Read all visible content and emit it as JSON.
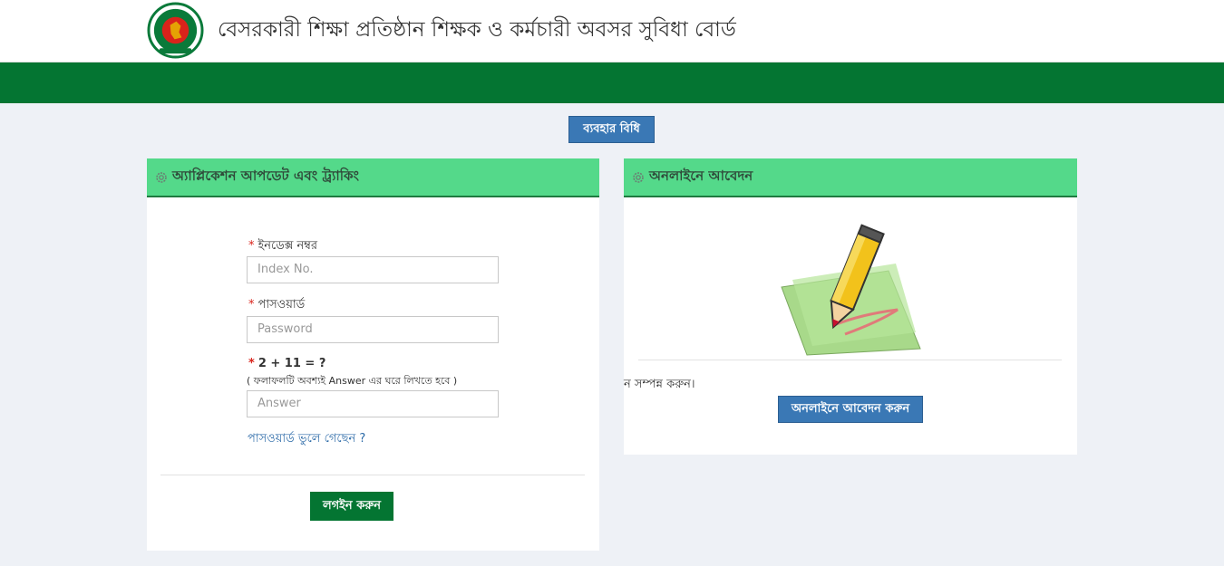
{
  "header": {
    "title": "বেসরকারী শিক্ষা প্রতিষ্ঠান শিক্ষক ও কর্মচারী অবসর সুবিধা বোর্ড",
    "logo_icon": "govt-seal-icon"
  },
  "rules_button": "ব্যবহার বিধি",
  "left_panel": {
    "title": "অ্যাপ্লিকেশন আপডেট এবং ট্র্যাকিং",
    "index_label": "ইনডেক্স নম্বর",
    "index_placeholder": "Index No.",
    "password_label": "পাসওয়ার্ড",
    "password_placeholder": "Password",
    "captcha_question": "2 + 11 = ?",
    "captcha_note": "( ফলাফলটি অবশ্যই Answer এর ঘরে লিখতে হবে )",
    "answer_placeholder": "Answer",
    "forgot_link": "পাসওয়ার্ড ভুলে গেছেন ?",
    "login_button": "লগইন করুন",
    "required_marker": "*"
  },
  "right_panel": {
    "title": "অনলাইনে আবেদন",
    "text": "ন সম্পন্ন করুন।",
    "apply_button": "অনলাইনে আবেদন করুন",
    "image_icon": "pencil-paper-icon"
  },
  "colors": {
    "green_bar": "#047532",
    "panel_header": "#54d98a",
    "blue_button": "#3a78b5"
  }
}
